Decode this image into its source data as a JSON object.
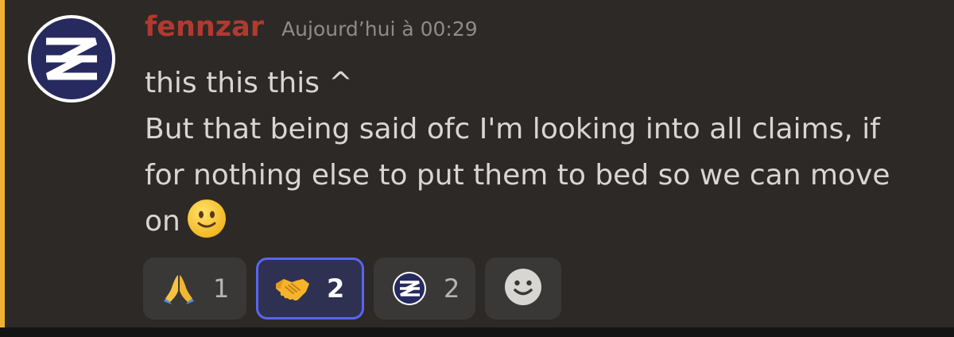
{
  "message": {
    "author": "fennzar",
    "timestamp": "Aujourd’hui à 00:29",
    "lines": [
      "this this this ^",
      "But that being said ofc I'm looking into all claims, if",
      "for nothing else to put them to bed so we can move",
      "on"
    ],
    "inline_emoji": "slightly-smiling-face-icon"
  },
  "reactions": [
    {
      "emoji": "folded-hands-icon",
      "count": "1",
      "active": false
    },
    {
      "emoji": "handshake-icon",
      "count": "2",
      "active": true
    },
    {
      "emoji": "zephyr-logo-icon",
      "count": "2",
      "active": false
    }
  ],
  "add_reaction": {
    "icon": "add-reaction-smiley-icon"
  },
  "colors": {
    "background": "#2d2926",
    "username": "#b03a30",
    "mention_bar": "#efb033",
    "active_reaction_border": "#5865f2"
  }
}
